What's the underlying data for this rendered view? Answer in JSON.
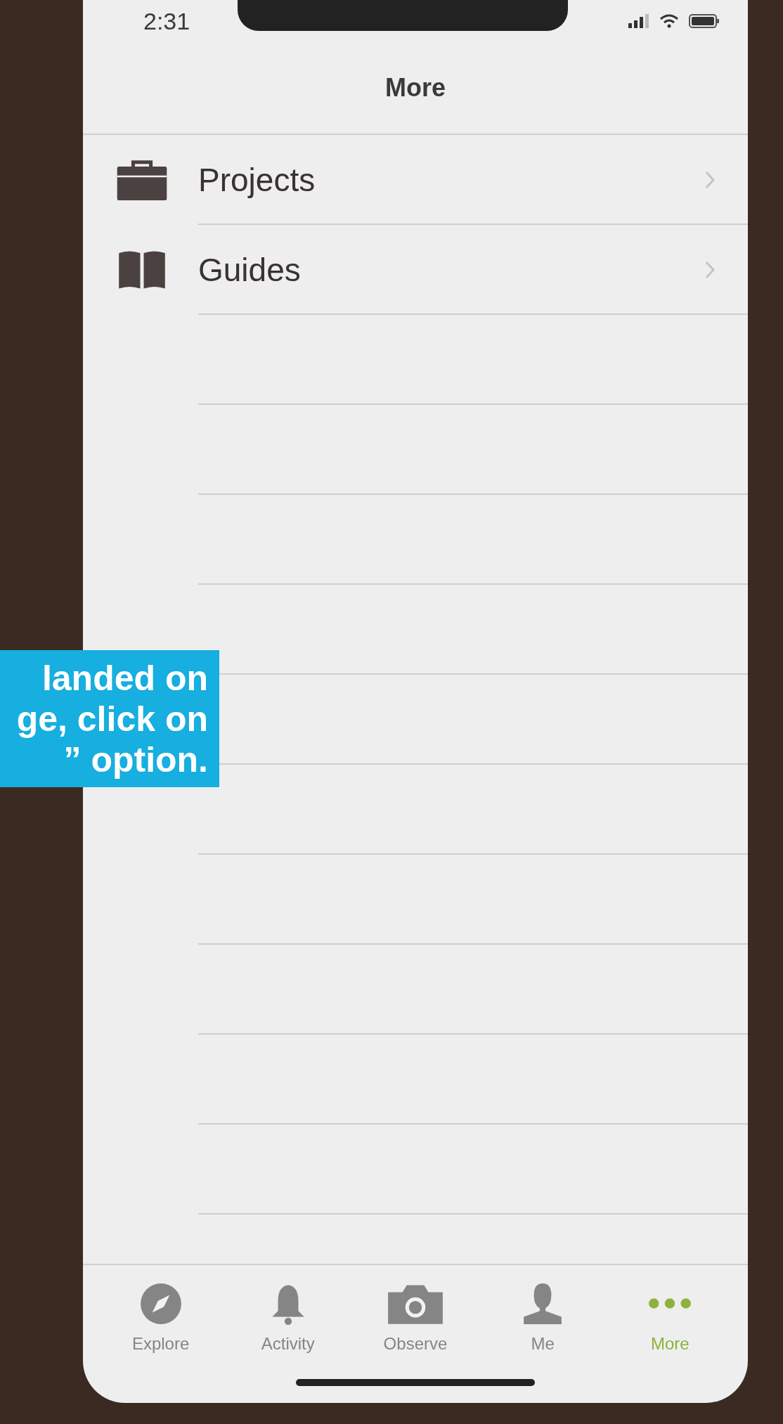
{
  "status_bar": {
    "time": "2:31"
  },
  "nav_bar": {
    "title": "More"
  },
  "menu_items": [
    {
      "label": "Projects"
    },
    {
      "label": "Guides"
    }
  ],
  "tab_bar": [
    {
      "label": "Explore",
      "selected": false
    },
    {
      "label": "Activity",
      "selected": false
    },
    {
      "label": "Observe",
      "selected": false
    },
    {
      "label": "Me",
      "selected": false
    },
    {
      "label": "More",
      "selected": true
    }
  ],
  "caption": {
    "lines": [
      "landed on",
      "ge, click on",
      "” option."
    ]
  }
}
